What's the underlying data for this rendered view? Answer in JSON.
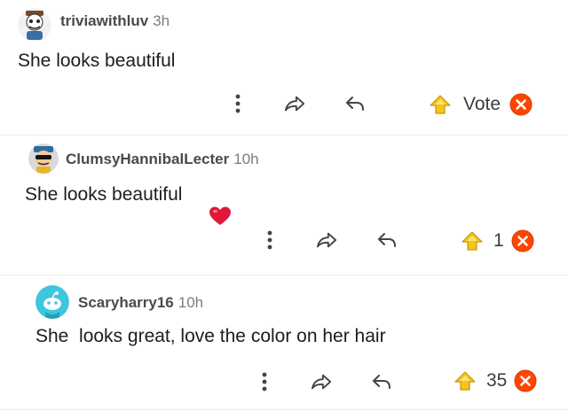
{
  "comments": [
    {
      "username": "triviawithluv",
      "age": "3h",
      "text": "She looks beautiful",
      "vote_label": "Vote"
    },
    {
      "username": "ClumsyHannibalLecter",
      "age": "10h",
      "text": "She looks beautiful",
      "vote_label": "1"
    },
    {
      "username": "Scaryharry16",
      "age": "10h",
      "text": "She  looks great, love the color on her hair",
      "vote_label": "35"
    }
  ],
  "icons": {
    "more": "more-vertical-icon",
    "share": "share-arrow-icon",
    "reply": "reply-arrow-icon",
    "upvote": "upvote-arrow-icon",
    "downvote": "downvote-icon",
    "heart": "heart-icon"
  },
  "colors": {
    "upvote": "#f5c518",
    "downvote": "#ff4500",
    "heart": "#e0193b",
    "avatar3": "#3ec5e0"
  }
}
